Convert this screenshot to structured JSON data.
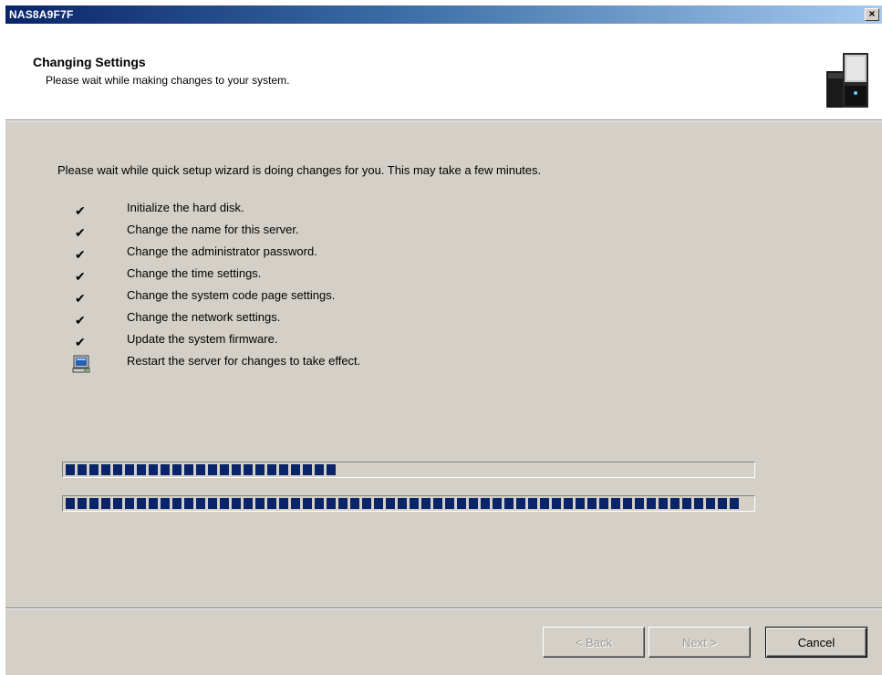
{
  "window": {
    "title": "NAS8A9F7F",
    "close_label": "×"
  },
  "header": {
    "title": "Changing Settings",
    "subtitle": "Please wait while making changes to your system.",
    "icon": "nas-server-icon"
  },
  "intro": "Please wait while quick setup wizard is doing changes for you.  This may take a few minutes.",
  "steps": [
    {
      "label": "Initialize the hard disk.",
      "status": "done",
      "icon": "✔"
    },
    {
      "label": "Change the name for this server.",
      "status": "done",
      "icon": "✔"
    },
    {
      "label": "Change the administrator password.",
      "status": "done",
      "icon": "✔"
    },
    {
      "label": "Change the time settings.",
      "status": "done",
      "icon": "✔"
    },
    {
      "label": "Change the system code page settings.",
      "status": "done",
      "icon": "✔"
    },
    {
      "label": "Change the network settings.",
      "status": "done",
      "icon": "✔"
    },
    {
      "label": "Update the system firmware.",
      "status": "done",
      "icon": "✔"
    },
    {
      "label": "Restart the server for changes to take effect.",
      "status": "in-progress",
      "icon": "computer-icon"
    }
  ],
  "progress": {
    "current_step_fraction": 0.41,
    "overall_fraction": 1.0
  },
  "buttons": {
    "back": "< Back",
    "next": "Next >",
    "cancel": "Cancel"
  },
  "colors": {
    "progress_fill": "#0a246a",
    "titlebar_start": "#0a246a",
    "dialog_face": "#d4d0c8"
  }
}
